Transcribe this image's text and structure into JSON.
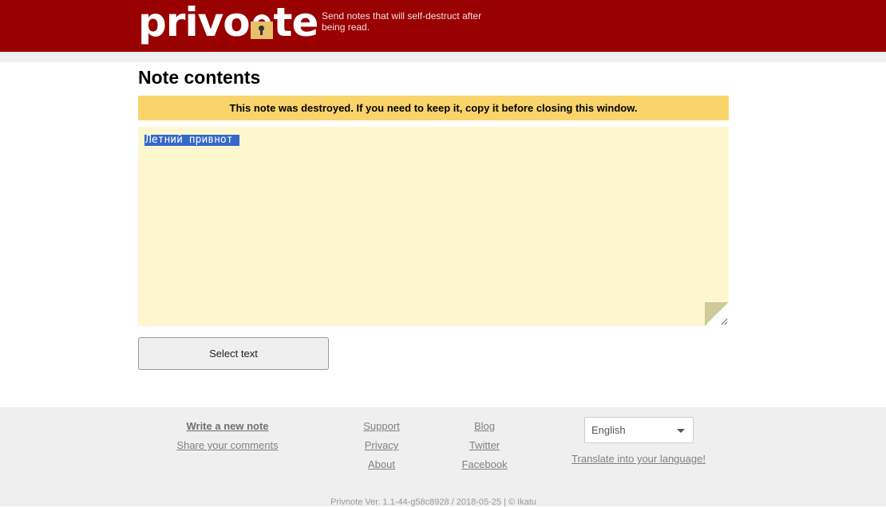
{
  "header": {
    "logo_left": "priv",
    "logo_right": "te",
    "tagline": "Send notes that will self-destruct after being read."
  },
  "main": {
    "title": "Note contents",
    "alert": "This note was destroyed. If you need to keep it, copy it before closing this window.",
    "note_text": "Летний привнот ",
    "select_button": "Select text"
  },
  "footer": {
    "write_new_note": "Write a new note",
    "share_comments": "Share your comments",
    "support": "Support",
    "privacy": "Privacy",
    "about": "About",
    "blog": "Blog",
    "twitter": "Twitter",
    "facebook": "Facebook",
    "language_selected": "English",
    "translate": "Translate into your language!",
    "version": "Privnote Ver. 1.1-44-g58c8928 / 2018-05-25 | © Ikatu"
  },
  "colors": {
    "header_bg": "#990000",
    "alert_bg": "#f9d46a",
    "note_bg": "#fdf7cf",
    "selection": "#3368c8"
  }
}
